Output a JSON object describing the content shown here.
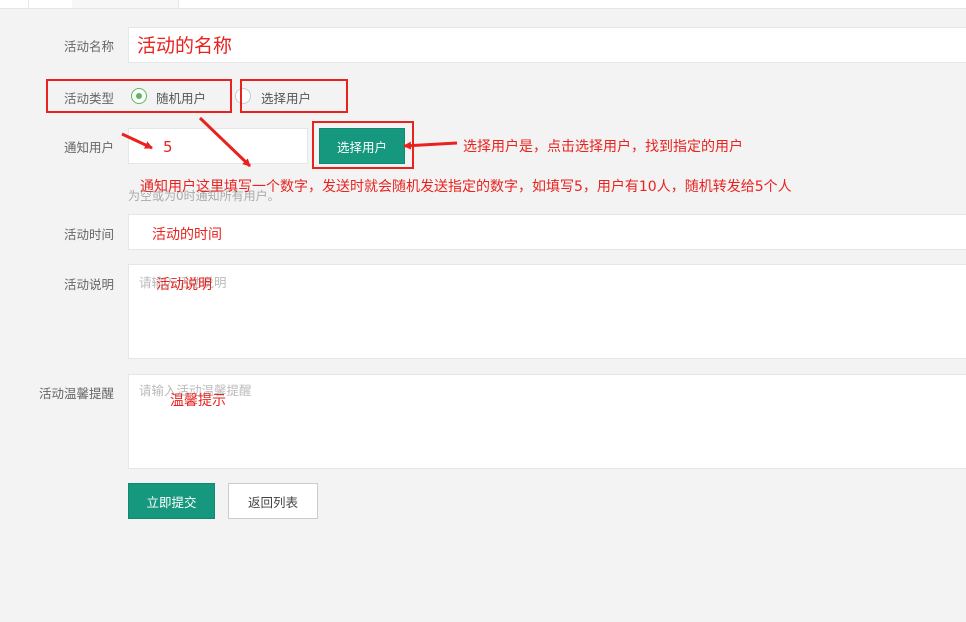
{
  "form": {
    "name": {
      "label": "活动名称",
      "value": ""
    },
    "type": {
      "label": "活动类型",
      "options": [
        {
          "label": "随机用户",
          "selected": true
        },
        {
          "label": "选择用户",
          "selected": false
        }
      ]
    },
    "notify": {
      "label": "通知用户",
      "value": "",
      "select_button": "选择用户",
      "help": "为空或为0时通知所有用户。"
    },
    "time": {
      "label": "活动时间",
      "value": ""
    },
    "description": {
      "label": "活动说明",
      "placeholder": "请输入活动说明"
    },
    "reminder": {
      "label": "活动温馨提醒",
      "placeholder": "请输入活动温馨提醒"
    }
  },
  "actions": {
    "submit": "立即提交",
    "back": "返回列表"
  },
  "annotations": {
    "name_hint": "活动的名称",
    "notify_value": "5",
    "select_hint": "选择用户是，点击选择用户，找到指定的用户",
    "notify_hint": "通知用户这里填写一个数字，发送时就会随机发送指定的数字，如填写5，用户有10人，随机转发给5个人",
    "time_hint": "活动的时间",
    "desc_hint": "活动说明",
    "reminder_hint": "温馨提示"
  },
  "colors": {
    "primary": "#16987e",
    "radio_checked": "#5cb85c",
    "annotation": "#e8231f"
  }
}
